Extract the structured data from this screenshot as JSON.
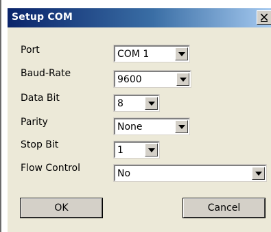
{
  "window": {
    "title": "Setup COM"
  },
  "colors": {
    "titlebar_start": "#0a246a",
    "titlebar_end": "#a6caf0",
    "dialog_face": "#ece9d8"
  },
  "icons": {
    "close": "close-icon",
    "dropdown": "chevron-down-icon"
  },
  "fields": {
    "port": {
      "label": "Port",
      "value": "COM 1"
    },
    "baud_rate": {
      "label": "Baud-Rate",
      "value": "9600"
    },
    "data_bit": {
      "label": "Data Bit",
      "value": "8"
    },
    "parity": {
      "label": "Parity",
      "value": "None"
    },
    "stop_bit": {
      "label": "Stop Bit",
      "value": "1"
    },
    "flow_control": {
      "label": "Flow Control",
      "value": "No"
    }
  },
  "buttons": {
    "ok": "OK",
    "cancel": "Cancel"
  }
}
